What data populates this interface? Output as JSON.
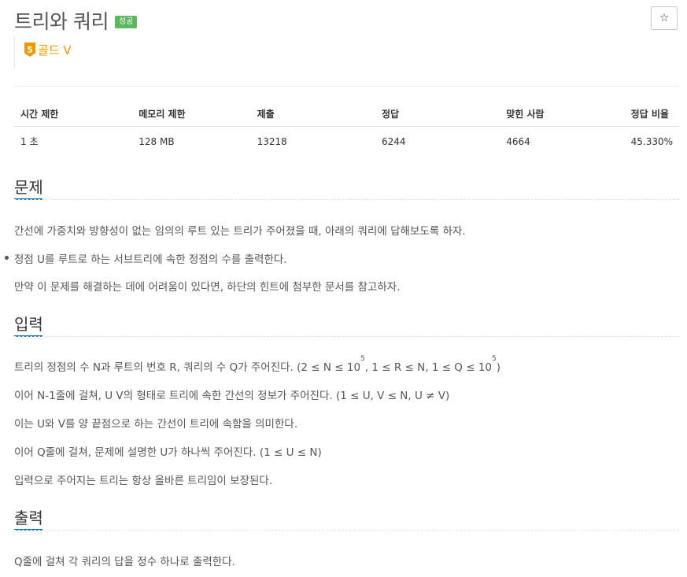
{
  "problem": {
    "title": "트리와 쿼리",
    "status_badge": "성공",
    "tier_number": "5",
    "tier_label": "골드 V",
    "star_icon": "☆"
  },
  "info_table": {
    "headers": [
      "시간 제한",
      "메모리 제한",
      "제출",
      "정답",
      "맞힌 사람",
      "정답 비율"
    ],
    "values": [
      "1 초",
      "128 MB",
      "13218",
      "6244",
      "4664",
      "45.330%"
    ]
  },
  "sections": {
    "description": {
      "title": "문제",
      "line1": "간선에 가중치와 방향성이 없는 임의의 루트 있는 트리가 주어졌을 때, 아래의 쿼리에 답해보도록 하자.",
      "bullet1": "정점 U를 루트로 하는 서브트리에 속한 정점의 수를 출력한다.",
      "line2": "만약 이 문제를 해결하는 데에 어려움이 있다면, 하단의 힌트에 첨부한 문서를 참고하자."
    },
    "input": {
      "title": "입력",
      "line1_a": "트리의 정점의 수 N과 루트의 번호 R, 쿼리의 수 Q가 주어진다. (2 ≤ N ≤ 10",
      "line1_sup1": "5",
      "line1_b": ", 1 ≤ R ≤ N, 1 ≤ Q ≤ 10",
      "line1_sup2": "5",
      "line1_c": ")",
      "line2": "이어 N-1줄에 걸쳐, U V의 형태로 트리에 속한 간선의 정보가 주어진다. (1 ≤ U, V ≤ N, U ≠ V)",
      "line3": "이는 U와 V를 양 끝점으로 하는 간선이 트리에 속함을 의미한다.",
      "line4": "이어 Q줄에 걸쳐, 문제에 설명한 U가 하나씩 주어진다. (1 ≤ U ≤ N)",
      "line5": "입력으로 주어지는 트리는 항상 올바른 트리임이 보장된다."
    },
    "output": {
      "title": "출력",
      "line1": "Q줄에 걸쳐 각 쿼리의 답을 정수 하나로 출력한다."
    }
  },
  "colors": {
    "success_badge": "#5cb85c",
    "gold_tier": "#ec9a00",
    "section_accent": "#0076c0"
  }
}
